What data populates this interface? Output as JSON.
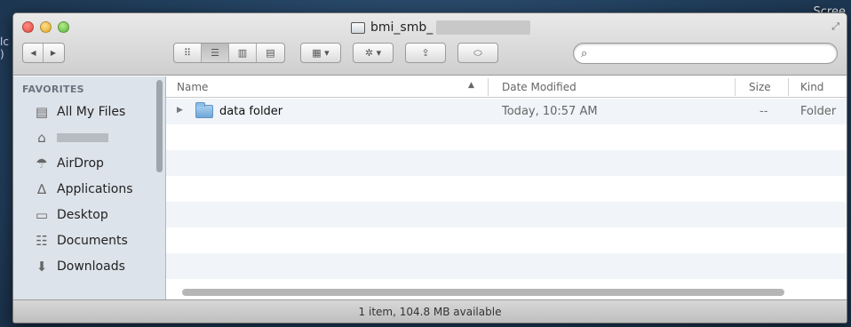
{
  "desktop": {
    "corner_label": "Scree",
    "edge_text": "lc )"
  },
  "window": {
    "title": "bmi_smb_",
    "search": {
      "value": "",
      "placeholder": ""
    }
  },
  "toolbar": {
    "back_glyph": "◀",
    "forward_glyph": "▶",
    "view_icons": [
      "icon-view-icon",
      "list-view-icon",
      "column-view-icon",
      "coverflow-view-icon"
    ],
    "arrange_glyph": "▦ ▾",
    "action_glyph": "✲ ▾",
    "share_glyph": "⇪",
    "tags_glyph": "⬭"
  },
  "sidebar": {
    "header": "FAVORITES",
    "items": [
      {
        "label": "All My Files",
        "icon": "all-files-icon"
      },
      {
        "label": "",
        "icon": "home-icon"
      },
      {
        "label": "AirDrop",
        "icon": "airdrop-icon"
      },
      {
        "label": "Applications",
        "icon": "applications-icon"
      },
      {
        "label": "Desktop",
        "icon": "desktop-icon"
      },
      {
        "label": "Documents",
        "icon": "documents-icon"
      },
      {
        "label": "Downloads",
        "icon": "downloads-icon"
      }
    ]
  },
  "columns": {
    "name": "Name",
    "date_modified": "Date Modified",
    "size": "Size",
    "kind": "Kind"
  },
  "rows": [
    {
      "name": "data folder",
      "date_modified": "Today, 10:57 AM",
      "size": "--",
      "kind": "Folder"
    }
  ],
  "status": "1 item, 104.8 MB available"
}
